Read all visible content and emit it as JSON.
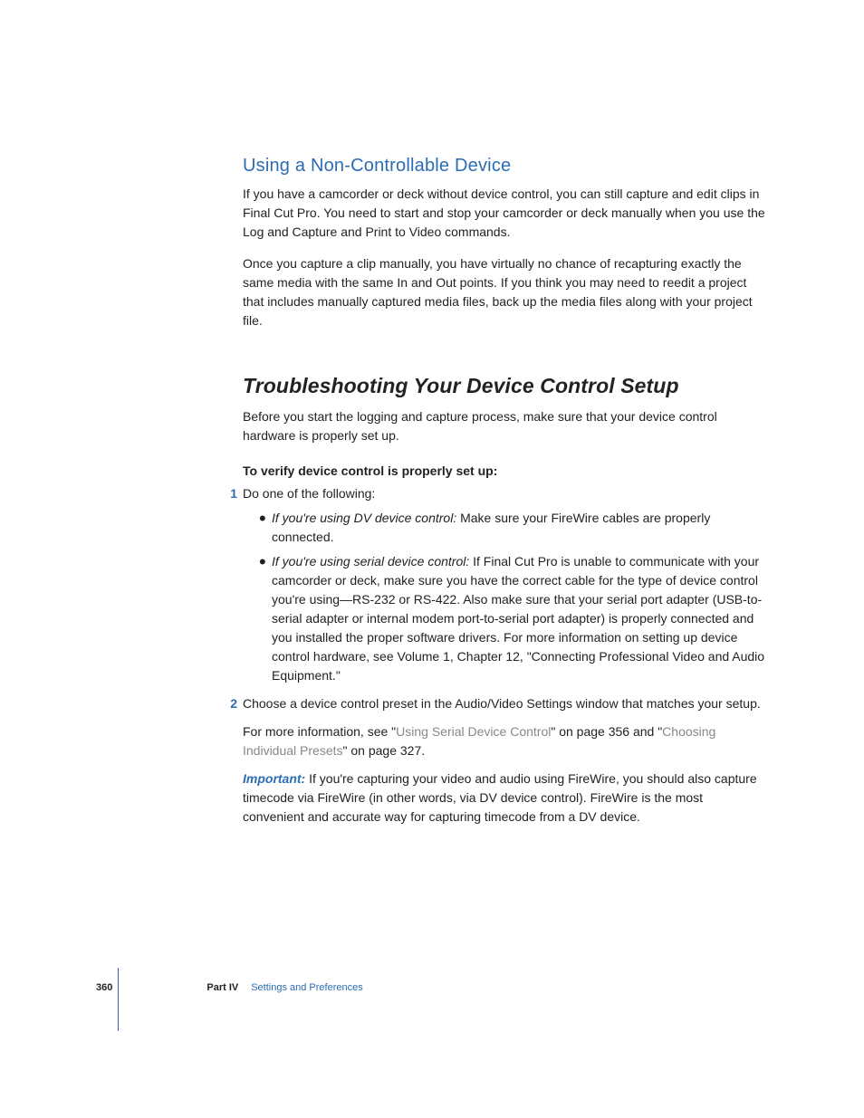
{
  "section1": {
    "heading": "Using a Non-Controllable Device",
    "para1": "If you have a camcorder or deck without device control, you can still capture and edit clips in Final Cut Pro. You need to start and stop your camcorder or deck manually when you use the Log and Capture and Print to Video commands.",
    "para2": "Once you capture a clip manually, you have virtually no chance of recapturing exactly the same media with the same In and Out points. If you think you may need to reedit a project that includes manually captured media files, back up the media files along with your project file."
  },
  "section2": {
    "heading": "Troubleshooting Your Device Control Setup",
    "intro": "Before you start the logging and capture process, make sure that your device control hardware is properly set up.",
    "verify_label": "To verify device control is properly set up:",
    "steps": [
      {
        "num": "1",
        "text": "Do one of the following:",
        "bullets": [
          {
            "lead": "If you're using DV device control:",
            "rest": "  Make sure your FireWire cables are properly connected."
          },
          {
            "lead": "If you're using serial device control:",
            "rest": "  If Final Cut Pro is unable to communicate with your camcorder or deck, make sure you have the correct cable for the type of device control you're using—RS-232 or RS-422. Also make sure that your serial port adapter (USB-to-serial adapter or internal modem port-to-serial port adapter) is properly connected and you installed the proper software drivers. For more information on setting up device control hardware, see Volume 1, Chapter 12, \"Connecting Professional Video and Audio Equipment.\""
          }
        ]
      },
      {
        "num": "2",
        "text": "Choose a device control preset in the Audio/Video Settings window that matches your setup.",
        "more_pre": "For more information, see \"",
        "link1": "Using Serial Device Control",
        "more_mid": "\" on page 356 and \"",
        "link2": "Choosing Individual Presets",
        "more_post": "\" on page 327."
      }
    ],
    "important": {
      "label": "Important:",
      "text": "  If you're capturing your video and audio using FireWire, you should also capture timecode via FireWire (in other words, via DV device control). FireWire is the most convenient and accurate way for capturing timecode from a DV device."
    }
  },
  "footer": {
    "page_number": "360",
    "part": "Part IV",
    "section": "Settings and Preferences"
  }
}
